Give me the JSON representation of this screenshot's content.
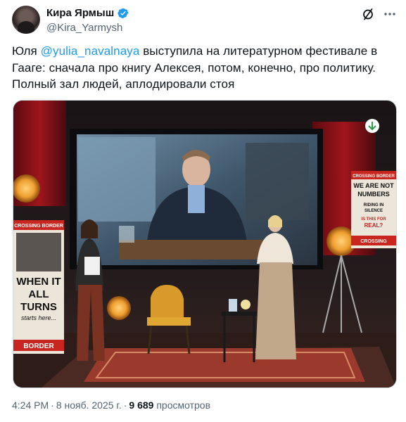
{
  "author": {
    "display_name": "Кира Ярмыш",
    "handle": "@Kira_Yarmysh"
  },
  "tweet": {
    "text_before": "Юля ",
    "mention": "@yulia_navalnaya",
    "text_after": " выступила на литературном фестивале в Гааге: сначала про книгу Алексея, потом, конечно, про политику. Полный зал людей, аплодировали стоя"
  },
  "media": {
    "poster_left": {
      "line1": "CROSSING BORDER",
      "line2": "WHEN IT",
      "line3": "ALL",
      "line4": "TURNS",
      "line5": "starts here...",
      "line6": "BORDER"
    },
    "poster_right": {
      "line1": "CROSSING BORDER",
      "line2": "WE ARE NOT",
      "line3": "NUMBERS",
      "line4": "RIDING IN",
      "line5": "SILENCE",
      "line6": "IS THIS FOR",
      "line7": "REAL?",
      "line8": "CROSSING"
    }
  },
  "meta": {
    "time": "4:24 PM",
    "separator": "·",
    "date": "8 нояб. 2025 г.",
    "views_count": "9 689",
    "views_label": "просмотров"
  },
  "icons": {
    "verified": "verified-badge-icon",
    "grok": "grok-icon",
    "more": "more-options-icon"
  },
  "colors": {
    "accent": "#1d9bf0",
    "secondary_text": "#536471"
  }
}
